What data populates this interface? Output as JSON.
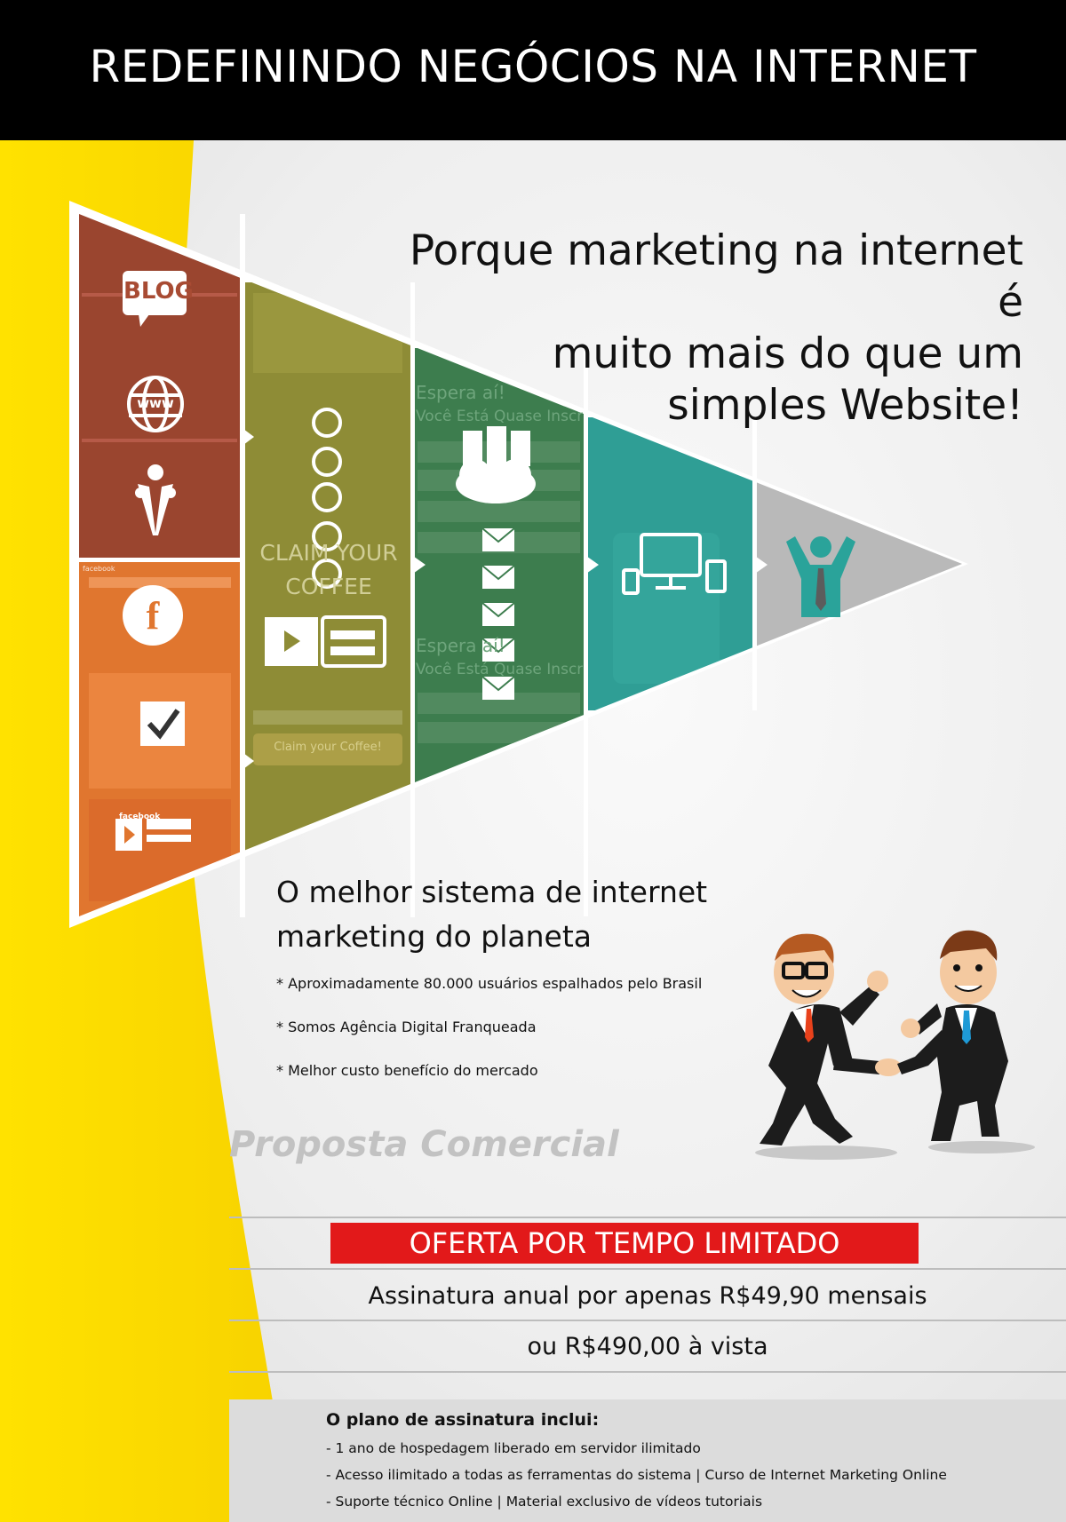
{
  "header": {
    "title": "REDEFININDO NEGÓCIOS NA INTERNET"
  },
  "headline": {
    "line1": "Porque marketing na internet é",
    "line2": "muito mais do que um",
    "line3": "simples Website!"
  },
  "pyramid": {
    "panel1_icons": [
      "blog-icon",
      "www-globe-icon",
      "people-icon"
    ],
    "panel1_blog_label": "BLOG",
    "panel1_www_label": "www",
    "panel1b_icons": [
      "facebook-icon",
      "checkbox-icon",
      "form-icon"
    ],
    "panel1b_fb_label": "f",
    "panel1b_screen_label1": "facebook",
    "panel1b_screen_label2": "facebook",
    "panel2_icons": [
      "at-sign-icon",
      "video-form-icon"
    ],
    "panel2_claim_line1": "CLAIM YOUR",
    "panel2_claim_line2": "COFFEE",
    "panel2_button": "Claim your Coffee!",
    "panel3_icons": [
      "server-cloud-icon",
      "envelope-icon"
    ],
    "panel3_text1": "Espera aí!",
    "panel3_text2": "Você Está Quase Inscri",
    "panel3_text3": "Espera aí!",
    "panel3_text4": "Você Está Quase Inscri",
    "panel4_icons": [
      "devices-icon"
    ],
    "panel5_icons": [
      "success-person-icon"
    ],
    "colors": {
      "panel1_top": "#a84b33",
      "panel1_bottom": "#e0762f",
      "panel2": "#8e8c36",
      "panel3": "#3d7d4e",
      "panel4": "#2f9e95",
      "panel5": "#b9b9b9",
      "icon_teal": "#2aa39a"
    }
  },
  "sub": {
    "line1": "O melhor sistema de internet",
    "line2": "marketing do planeta"
  },
  "bullets": [
    "* Aproximadamente 80.000 usuários espalhados pelo Brasil",
    "* Somos Agência Digital Franqueada",
    "* Melhor custo benefício do mercado"
  ],
  "illustration": {
    "icon": "businessmen-handshake-illustration"
  },
  "watermark": "Proposta Comercial",
  "offer": {
    "label": "OFERTA POR TEMPO LIMITADO",
    "color": "#e2191a",
    "price_line1": "Assinatura anual por apenas R$49,90 mensais",
    "price_line2": "ou R$490,00 à vista"
  },
  "plan": {
    "title": "O plano de assinatura inclui:",
    "items": [
      "- 1 ano de hospedagem liberado em servidor ilimitado",
      "- Acesso ilimitado a todas as ferramentas do sistema | Curso de Internet Marketing Online",
      "- Suporte técnico Online | Material exclusivo de vídeos tutoriais"
    ]
  },
  "theme": {
    "yellow": "#ffdd00",
    "black": "#000000"
  }
}
